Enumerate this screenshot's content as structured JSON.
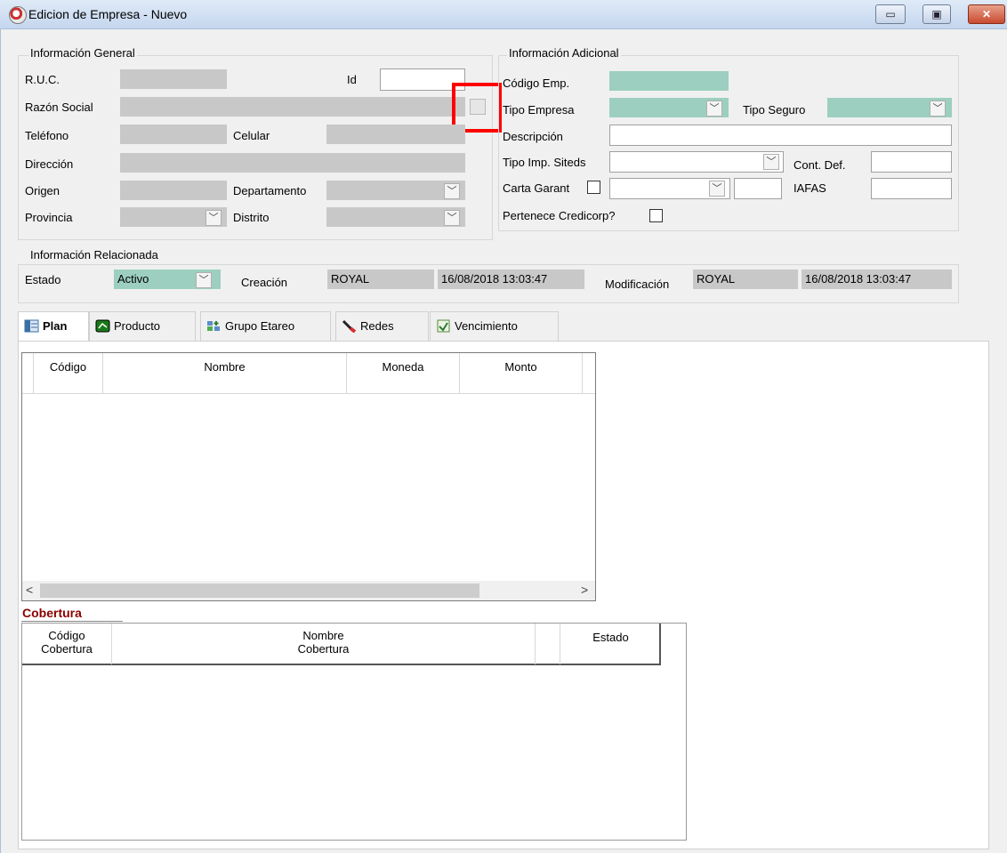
{
  "window": {
    "title": "Edicion de Empresa - Nuevo",
    "minimize": "▭",
    "maximize": "▣",
    "close": "✕"
  },
  "general": {
    "title": "Información General",
    "ruc_label": "R.U.C.",
    "id_label": "Id",
    "razon_label": "Razón Social",
    "telefono_label": "Teléfono",
    "celular_label": "Celular",
    "direccion_label": "Dirección",
    "origen_label": "Origen",
    "departamento_label": "Departamento",
    "provincia_label": "Provincia",
    "distrito_label": "Distrito"
  },
  "adicional": {
    "title": "Información Adicional",
    "codigo_label": "Código Emp.",
    "tipo_empresa_label": "Tipo Empresa",
    "tipo_seguro_label": "Tipo Seguro",
    "descripcion_label": "Descripción",
    "tipo_imp_label": "Tipo Imp. Siteds",
    "cont_def_label": "Cont. Def.",
    "carta_label": "Carta Garant",
    "iafas_label": "IAFAS",
    "pertenece_label": "Pertenece Credicorp?"
  },
  "relacionada": {
    "title": "Información Relacionada",
    "estado_label": "Estado",
    "estado_value": "Activo",
    "creacion_label": "Creación",
    "creacion_user": "ROYAL",
    "creacion_date": "16/08/2018 13:03:47",
    "modificacion_label": "Modificación",
    "modificacion_user": "ROYAL",
    "modificacion_date": "16/08/2018 13:03:47"
  },
  "tabs": [
    {
      "label": "Plan",
      "icon": "plan-icon"
    },
    {
      "label": "Producto",
      "icon": "producto-icon"
    },
    {
      "label": "Grupo Etareo",
      "icon": "grupo-icon"
    },
    {
      "label": "Redes",
      "icon": "redes-icon"
    },
    {
      "label": "Vencimiento",
      "icon": "vencimiento-icon"
    }
  ],
  "plan_grid": {
    "columns": [
      "Código",
      "Nombre",
      "Moneda",
      "Monto"
    ],
    "scroll_left": "<",
    "scroll_right": ">"
  },
  "cobertura": {
    "title": "Cobertura",
    "col1_line1": "Código",
    "col1_line2": "Cobertura",
    "col2_line1": "Nombre",
    "col2_line2": "Cobertura",
    "col3": "Estado"
  },
  "dropdown_glyph": "﹀",
  "colors": {
    "accent_teal": "#9ccfbf",
    "disabled_gray": "#c8c8c8",
    "cobertura_red": "#8b0000",
    "highlight_red": "#ff0000"
  }
}
